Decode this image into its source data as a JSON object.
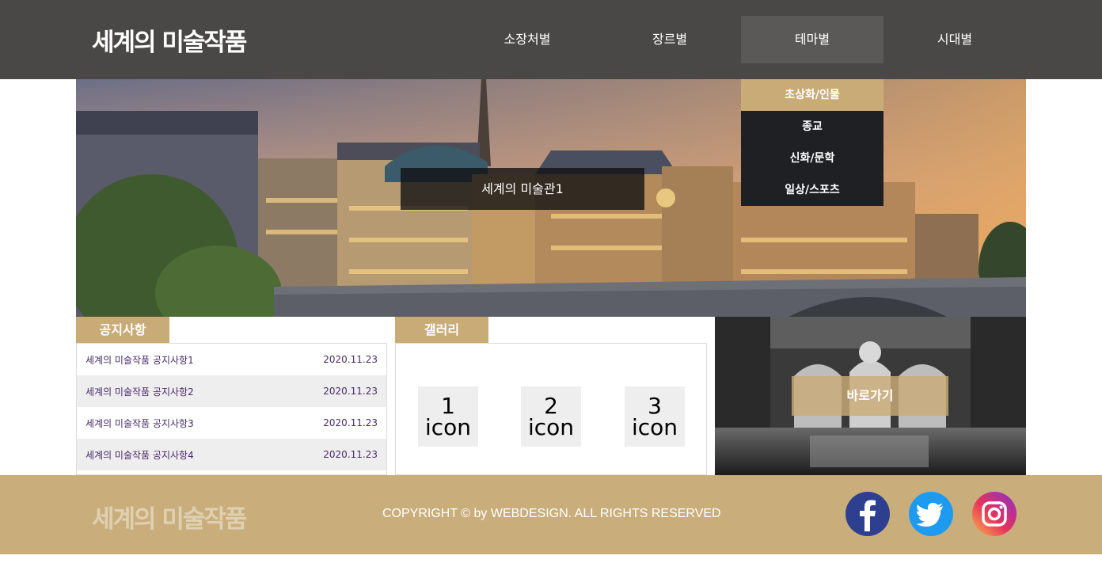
{
  "header": {
    "logo": "세계의 미술작품",
    "nav": [
      {
        "label": "소장처별"
      },
      {
        "label": "장르별"
      },
      {
        "label": "테마별"
      },
      {
        "label": "시대별"
      }
    ],
    "dropdown": [
      {
        "label": "초상화/인물"
      },
      {
        "label": "종교"
      },
      {
        "label": "신화/문학"
      },
      {
        "label": "일상/스포츠"
      }
    ]
  },
  "hero": {
    "caption": "세계의 미술관1"
  },
  "notice": {
    "tab": "공지사항",
    "items": [
      {
        "title": "세계의 미술작품 공지사항1",
        "date": "2020.11.23"
      },
      {
        "title": "세계의 미술작품 공지사항2",
        "date": "2020.11.23"
      },
      {
        "title": "세계의 미술작품 공지사항3",
        "date": "2020.11.23"
      },
      {
        "title": "세계의 미술작품 공지사항4",
        "date": "2020.11.23"
      }
    ]
  },
  "gallery": {
    "tab": "갤러리",
    "items": [
      {
        "num": "1",
        "word": "icon"
      },
      {
        "num": "2",
        "word": "icon"
      },
      {
        "num": "3",
        "word": "icon"
      }
    ]
  },
  "shortcut": {
    "label": "바로가기"
  },
  "footer": {
    "logo": "세계의 미술작품",
    "copyright": "COPYRIGHT © by WEBDESIGN. ALL RIGHTS RESERVED",
    "social": [
      "facebook-icon",
      "twitter-icon",
      "instagram-icon"
    ]
  },
  "colors": {
    "header_bg": "#4a4846",
    "accent": "#c9ab77",
    "dropdown_bg": "#1f2024",
    "footer_bg": "#c9ae7c"
  }
}
